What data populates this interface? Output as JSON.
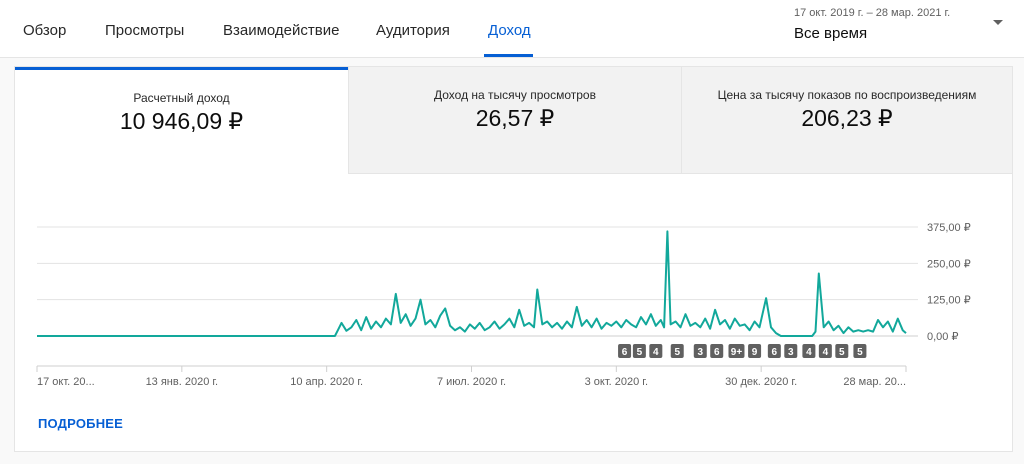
{
  "tabs": [
    {
      "label": "Обзор",
      "active": false
    },
    {
      "label": "Просмотры",
      "active": false
    },
    {
      "label": "Взаимодействие",
      "active": false
    },
    {
      "label": "Аудитория",
      "active": false
    },
    {
      "label": "Доход",
      "active": true
    }
  ],
  "date_range": {
    "dates": "17 окт. 2019 г. – 28 мар. 2021 г.",
    "name": "Все время"
  },
  "metrics": [
    {
      "label": "Расчетный доход",
      "value": "10 946,09 ₽"
    },
    {
      "label": "Доход на тысячу просмотров",
      "value": "26,57 ₽"
    },
    {
      "label": "Цена за тысячу показов по воспроизведениям",
      "value": "206,23 ₽"
    }
  ],
  "more_link": "ПОДРОБНЕЕ",
  "colors": {
    "accent": "#065fd4",
    "line": "#12a89b",
    "badge": "#606060"
  },
  "chart_data": {
    "type": "line",
    "x_start": "2019-10-17",
    "x_end": "2021-03-28",
    "y_ticks": [
      "375,00 ₽",
      "250,00 ₽",
      "125,00 ₽",
      "0,00 ₽"
    ],
    "ylim": [
      0,
      375
    ],
    "x_tick_labels": [
      "17 окт. 20...",
      "13 янв. 2020 г.",
      "10 апр. 2020 г.",
      "7 июл. 2020 г.",
      "3 окт. 2020 г.",
      "30 дек. 2020 г.",
      "28 мар. 20..."
    ],
    "x_tick_dates": [
      "2019-10-17",
      "2020-01-13",
      "2020-04-10",
      "2020-07-07",
      "2020-10-03",
      "2020-12-30",
      "2021-03-28"
    ],
    "grid": true,
    "series": [
      {
        "points": [
          [
            "2019-10-17",
            0
          ],
          [
            "2020-04-09",
            0
          ],
          [
            "2020-04-15",
            0
          ],
          [
            "2020-04-17",
            22
          ],
          [
            "2020-04-19",
            45
          ],
          [
            "2020-04-22",
            18
          ],
          [
            "2020-04-25",
            30
          ],
          [
            "2020-04-28",
            55
          ],
          [
            "2020-05-01",
            20
          ],
          [
            "2020-05-04",
            65
          ],
          [
            "2020-05-07",
            25
          ],
          [
            "2020-05-10",
            50
          ],
          [
            "2020-05-13",
            30
          ],
          [
            "2020-05-16",
            60
          ],
          [
            "2020-05-19",
            40
          ],
          [
            "2020-05-22",
            145
          ],
          [
            "2020-05-25",
            45
          ],
          [
            "2020-05-28",
            75
          ],
          [
            "2020-05-31",
            35
          ],
          [
            "2020-06-03",
            60
          ],
          [
            "2020-06-06",
            125
          ],
          [
            "2020-06-09",
            40
          ],
          [
            "2020-06-12",
            55
          ],
          [
            "2020-06-15",
            30
          ],
          [
            "2020-06-18",
            70
          ],
          [
            "2020-06-21",
            95
          ],
          [
            "2020-06-24",
            35
          ],
          [
            "2020-06-27",
            20
          ],
          [
            "2020-06-30",
            30
          ],
          [
            "2020-07-03",
            15
          ],
          [
            "2020-07-06",
            40
          ],
          [
            "2020-07-09",
            25
          ],
          [
            "2020-07-12",
            45
          ],
          [
            "2020-07-15",
            20
          ],
          [
            "2020-07-18",
            30
          ],
          [
            "2020-07-21",
            50
          ],
          [
            "2020-07-24",
            25
          ],
          [
            "2020-07-27",
            40
          ],
          [
            "2020-07-30",
            60
          ],
          [
            "2020-08-02",
            30
          ],
          [
            "2020-08-05",
            90
          ],
          [
            "2020-08-08",
            35
          ],
          [
            "2020-08-11",
            45
          ],
          [
            "2020-08-14",
            30
          ],
          [
            "2020-08-16",
            160
          ],
          [
            "2020-08-19",
            40
          ],
          [
            "2020-08-22",
            50
          ],
          [
            "2020-08-25",
            30
          ],
          [
            "2020-08-28",
            45
          ],
          [
            "2020-08-31",
            25
          ],
          [
            "2020-09-03",
            50
          ],
          [
            "2020-09-06",
            30
          ],
          [
            "2020-09-09",
            100
          ],
          [
            "2020-09-12",
            35
          ],
          [
            "2020-09-15",
            55
          ],
          [
            "2020-09-18",
            30
          ],
          [
            "2020-09-21",
            60
          ],
          [
            "2020-09-24",
            25
          ],
          [
            "2020-09-27",
            45
          ],
          [
            "2020-09-30",
            35
          ],
          [
            "2020-10-03",
            50
          ],
          [
            "2020-10-06",
            30
          ],
          [
            "2020-10-09",
            55
          ],
          [
            "2020-10-12",
            40
          ],
          [
            "2020-10-15",
            30
          ],
          [
            "2020-10-18",
            65
          ],
          [
            "2020-10-21",
            40
          ],
          [
            "2020-10-24",
            75
          ],
          [
            "2020-10-27",
            35
          ],
          [
            "2020-10-30",
            55
          ],
          [
            "2020-11-01",
            30
          ],
          [
            "2020-11-03",
            360
          ],
          [
            "2020-11-05",
            40
          ],
          [
            "2020-11-08",
            50
          ],
          [
            "2020-11-11",
            30
          ],
          [
            "2020-11-14",
            75
          ],
          [
            "2020-11-17",
            35
          ],
          [
            "2020-11-20",
            45
          ],
          [
            "2020-11-23",
            30
          ],
          [
            "2020-11-26",
            60
          ],
          [
            "2020-11-29",
            25
          ],
          [
            "2020-12-02",
            90
          ],
          [
            "2020-12-05",
            40
          ],
          [
            "2020-12-08",
            55
          ],
          [
            "2020-12-11",
            25
          ],
          [
            "2020-12-14",
            60
          ],
          [
            "2020-12-17",
            35
          ],
          [
            "2020-12-20",
            40
          ],
          [
            "2020-12-23",
            20
          ],
          [
            "2020-12-26",
            50
          ],
          [
            "2020-12-29",
            30
          ],
          [
            "2021-01-02",
            130
          ],
          [
            "2021-01-05",
            30
          ],
          [
            "2021-01-08",
            10
          ],
          [
            "2021-01-11",
            0
          ],
          [
            "2021-01-30",
            0
          ],
          [
            "2021-02-01",
            15
          ],
          [
            "2021-02-03",
            215
          ],
          [
            "2021-02-06",
            30
          ],
          [
            "2021-02-09",
            50
          ],
          [
            "2021-02-12",
            20
          ],
          [
            "2021-02-15",
            35
          ],
          [
            "2021-02-18",
            10
          ],
          [
            "2021-02-21",
            30
          ],
          [
            "2021-02-24",
            15
          ],
          [
            "2021-02-27",
            20
          ],
          [
            "2021-03-02",
            15
          ],
          [
            "2021-03-05",
            20
          ],
          [
            "2021-03-08",
            15
          ],
          [
            "2021-03-11",
            55
          ],
          [
            "2021-03-14",
            30
          ],
          [
            "2021-03-17",
            50
          ],
          [
            "2021-03-20",
            15
          ],
          [
            "2021-03-23",
            60
          ],
          [
            "2021-03-26",
            20
          ],
          [
            "2021-03-28",
            10
          ]
        ]
      }
    ],
    "annotations": [
      {
        "label": "6",
        "date": "2020-10-08"
      },
      {
        "label": "5",
        "date": "2020-10-17"
      },
      {
        "label": "4",
        "date": "2020-10-27"
      },
      {
        "label": "5",
        "date": "2020-11-09"
      },
      {
        "label": "3",
        "date": "2020-11-23"
      },
      {
        "label": "6",
        "date": "2020-12-03"
      },
      {
        "label": "9+",
        "date": "2020-12-15"
      },
      {
        "label": "9",
        "date": "2020-12-26"
      },
      {
        "label": "6",
        "date": "2021-01-07"
      },
      {
        "label": "3",
        "date": "2021-01-17"
      },
      {
        "label": "4",
        "date": "2021-01-28"
      },
      {
        "label": "4",
        "date": "2021-02-07"
      },
      {
        "label": "5",
        "date": "2021-02-17"
      },
      {
        "label": "5",
        "date": "2021-02-28"
      }
    ]
  }
}
